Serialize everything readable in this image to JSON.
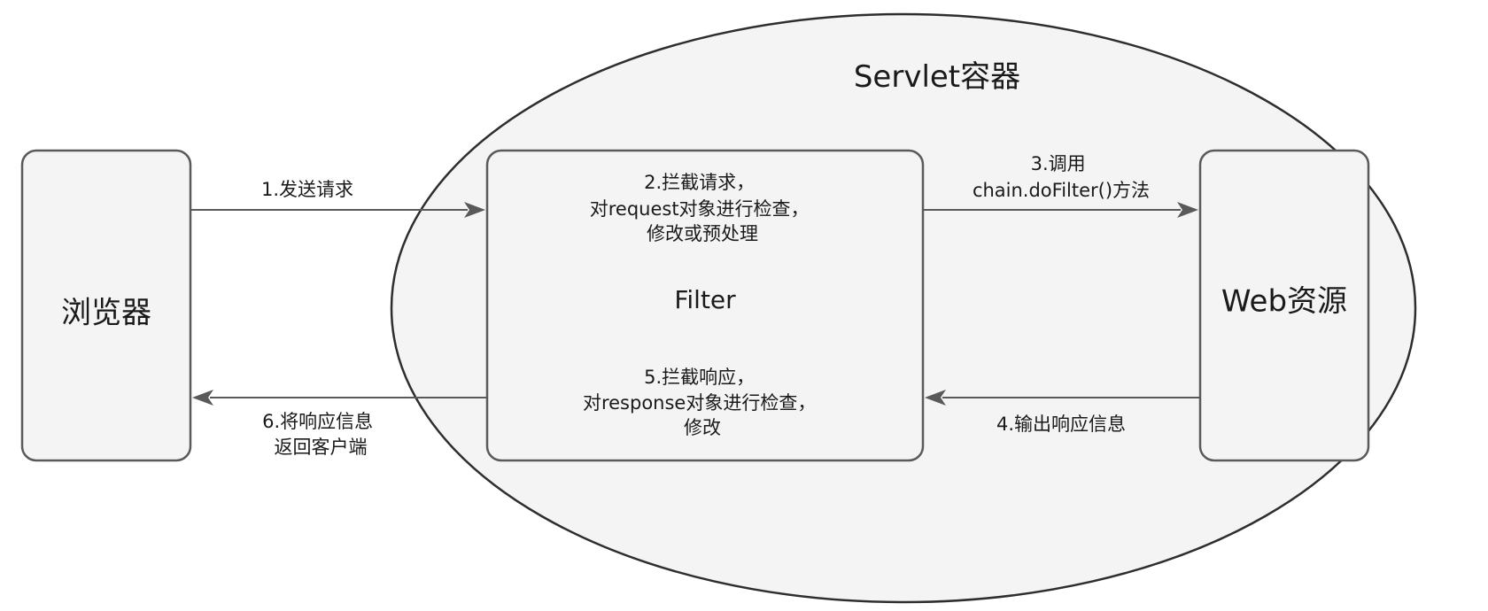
{
  "container": {
    "title": "Servlet容器"
  },
  "nodes": {
    "browser": "浏览器",
    "filter": "Filter",
    "web_resource": "Web资源"
  },
  "filter_notes": {
    "request": [
      "2.拦截请求，",
      "对request对象进行检查，",
      "修改或预处理"
    ],
    "response": [
      "5.拦截响应，",
      "对response对象进行检查，",
      "修改"
    ]
  },
  "edges": {
    "send_request": [
      "1.发送请求"
    ],
    "invoke": [
      "3.调用",
      "chain.doFilter()方法"
    ],
    "output_response": [
      "4.输出响应信息"
    ],
    "return_response": [
      "6.将响应信息",
      "返回客户端"
    ]
  },
  "colors": {
    "node_fill": "#f4f4f4",
    "node_stroke": "#5a5a5a",
    "arrow": "#595959",
    "text": "#1a1a1a"
  }
}
